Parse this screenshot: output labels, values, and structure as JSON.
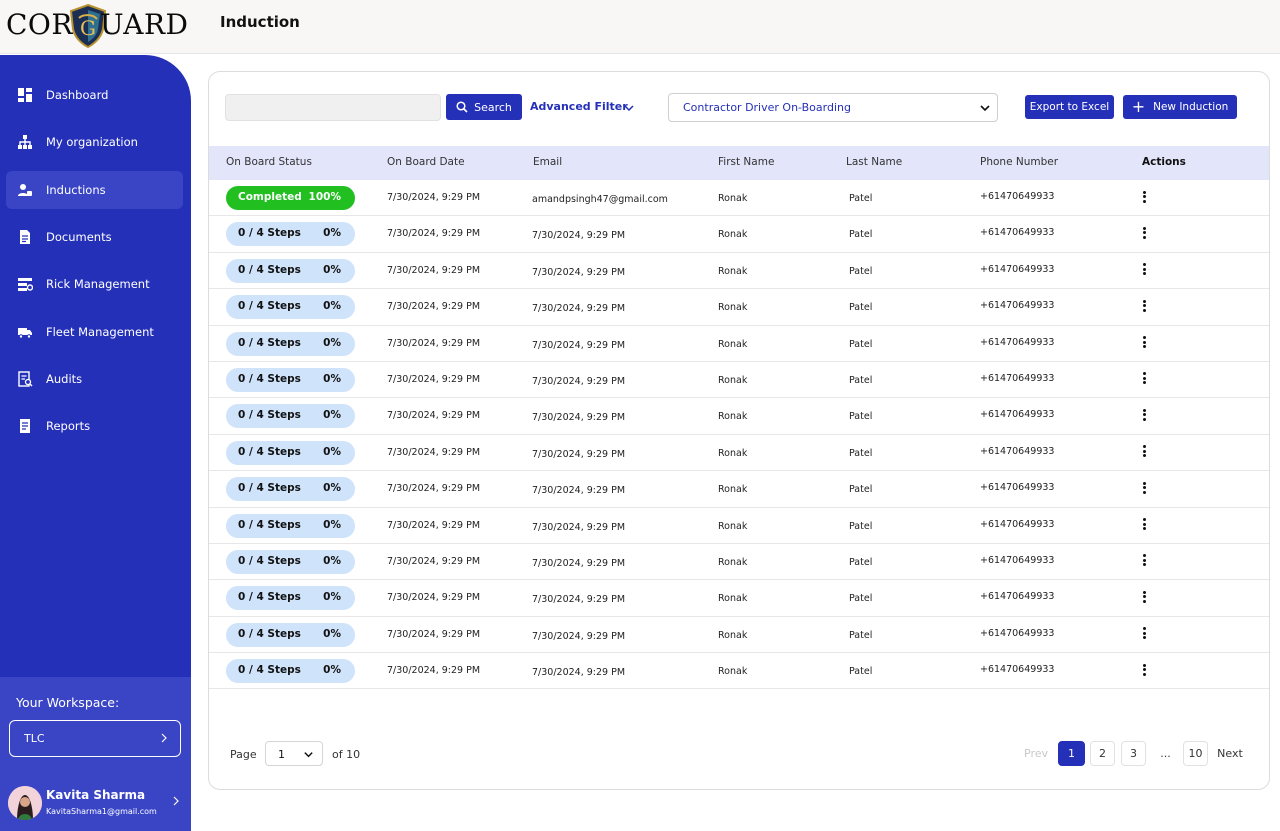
{
  "app": {
    "logo_left": "COR",
    "logo_right": "UARD",
    "page_title": "Induction"
  },
  "colors": {
    "brand": "#2530b8",
    "sidebar_active": "#3a45c6",
    "header_row": "#e3e5fb",
    "pill": "#cfe3fb",
    "completed": "#21c020"
  },
  "sidebar": {
    "items": [
      {
        "label": "Dashboard",
        "icon": "dashboard-icon"
      },
      {
        "label": "My organization",
        "icon": "org-tree-icon"
      },
      {
        "label": "Inductions",
        "icon": "user-inductions-icon",
        "active": true
      },
      {
        "label": "Documents",
        "icon": "document-icon"
      },
      {
        "label": "Rick Management",
        "icon": "risk-list-icon"
      },
      {
        "label": "Fleet Management",
        "icon": "truck-icon"
      },
      {
        "label": "Audits",
        "icon": "audit-icon"
      },
      {
        "label": "Reports",
        "icon": "report-icon"
      }
    ],
    "workspace_title": "Your Workspace:",
    "workspace_value": "TLC",
    "user_name": "Kavita Sharma",
    "user_email": "KavitaSharma1@gmail.com"
  },
  "toolbar": {
    "search_placeholder": "",
    "search_label": "Search",
    "advanced_filter_label": "Advanced Filter",
    "dropdown_value": "Contractor Driver On-Boarding",
    "export_label": "Export to Excel",
    "new_label": "New Induction"
  },
  "table": {
    "headers": [
      "On Board Status",
      "On Board Date",
      "Email",
      "First Name",
      "Last Name",
      "Phone Number",
      "Actions"
    ],
    "rows": [
      {
        "status": "Completed",
        "percent": "100%",
        "completed": true,
        "date": "7/30/2024, 9:29 PM",
        "email": "amandpsingh47@gmail.com",
        "first": "Ronak",
        "last": "Patel",
        "phone": "+61470649933"
      },
      {
        "status": "0 / 4 Steps",
        "percent": "0%",
        "completed": false,
        "date": "7/30/2024, 9:29 PM",
        "email": "7/30/2024, 9:29 PM",
        "first": "Ronak",
        "last": "Patel",
        "phone": "+61470649933"
      },
      {
        "status": "0 / 4 Steps",
        "percent": "0%",
        "completed": false,
        "date": "7/30/2024, 9:29 PM",
        "email": "7/30/2024, 9:29 PM",
        "first": "Ronak",
        "last": "Patel",
        "phone": "+61470649933"
      },
      {
        "status": "0 / 4 Steps",
        "percent": "0%",
        "completed": false,
        "date": "7/30/2024, 9:29 PM",
        "email": "7/30/2024, 9:29 PM",
        "first": "Ronak",
        "last": "Patel",
        "phone": "+61470649933"
      },
      {
        "status": "0 / 4 Steps",
        "percent": "0%",
        "completed": false,
        "date": "7/30/2024, 9:29 PM",
        "email": "7/30/2024, 9:29 PM",
        "first": "Ronak",
        "last": "Patel",
        "phone": "+61470649933"
      },
      {
        "status": "0 / 4 Steps",
        "percent": "0%",
        "completed": false,
        "date": "7/30/2024, 9:29 PM",
        "email": "7/30/2024, 9:29 PM",
        "first": "Ronak",
        "last": "Patel",
        "phone": "+61470649933"
      },
      {
        "status": "0 / 4 Steps",
        "percent": "0%",
        "completed": false,
        "date": "7/30/2024, 9:29 PM",
        "email": "7/30/2024, 9:29 PM",
        "first": "Ronak",
        "last": "Patel",
        "phone": "+61470649933"
      },
      {
        "status": "0 / 4 Steps",
        "percent": "0%",
        "completed": false,
        "date": "7/30/2024, 9:29 PM",
        "email": "7/30/2024, 9:29 PM",
        "first": "Ronak",
        "last": "Patel",
        "phone": "+61470649933"
      },
      {
        "status": "0 / 4 Steps",
        "percent": "0%",
        "completed": false,
        "date": "7/30/2024, 9:29 PM",
        "email": "7/30/2024, 9:29 PM",
        "first": "Ronak",
        "last": "Patel",
        "phone": "+61470649933"
      },
      {
        "status": "0 / 4 Steps",
        "percent": "0%",
        "completed": false,
        "date": "7/30/2024, 9:29 PM",
        "email": "7/30/2024, 9:29 PM",
        "first": "Ronak",
        "last": "Patel",
        "phone": "+61470649933"
      },
      {
        "status": "0 / 4 Steps",
        "percent": "0%",
        "completed": false,
        "date": "7/30/2024, 9:29 PM",
        "email": "7/30/2024, 9:29 PM",
        "first": "Ronak",
        "last": "Patel",
        "phone": "+61470649933"
      },
      {
        "status": "0 / 4 Steps",
        "percent": "0%",
        "completed": false,
        "date": "7/30/2024, 9:29 PM",
        "email": "7/30/2024, 9:29 PM",
        "first": "Ronak",
        "last": "Patel",
        "phone": "+61470649933"
      },
      {
        "status": "0 / 4 Steps",
        "percent": "0%",
        "completed": false,
        "date": "7/30/2024, 9:29 PM",
        "email": "7/30/2024, 9:29 PM",
        "first": "Ronak",
        "last": "Patel",
        "phone": "+61470649933"
      },
      {
        "status": "0 / 4 Steps",
        "percent": "0%",
        "completed": false,
        "date": "7/30/2024, 9:29 PM",
        "email": "7/30/2024, 9:29 PM",
        "first": "Ronak",
        "last": "Patel",
        "phone": "+61470649933"
      }
    ]
  },
  "pagination": {
    "page_label": "Page",
    "current": "1",
    "of_label": "of 10",
    "prev": "Prev",
    "pages": [
      "1",
      "2",
      "3",
      "...",
      "10"
    ],
    "next": "Next"
  }
}
